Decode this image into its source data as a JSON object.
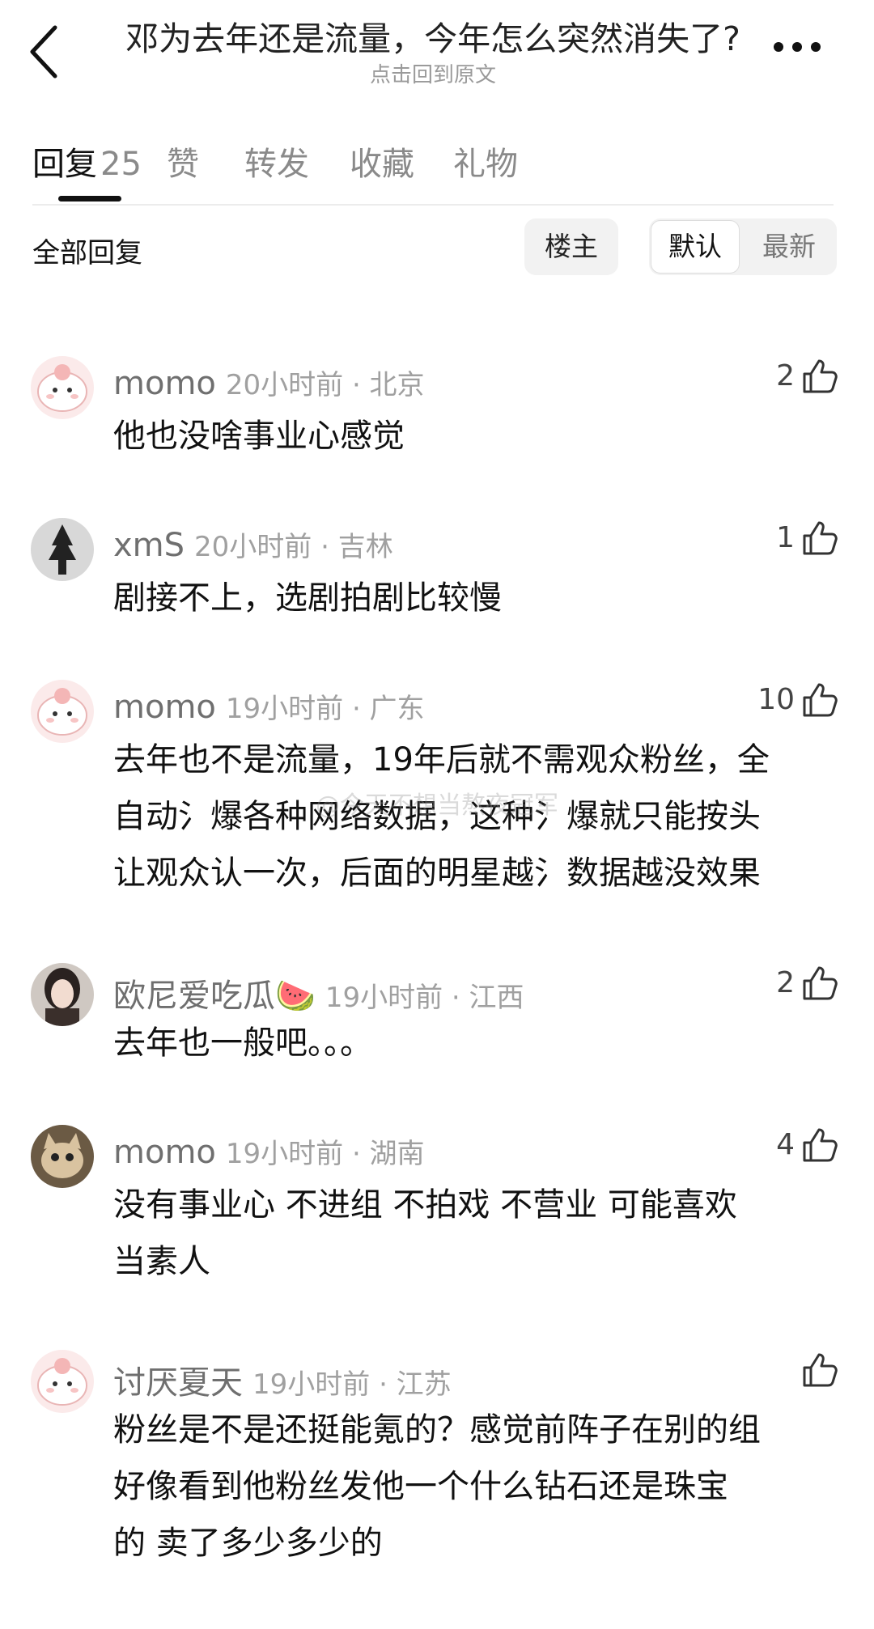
{
  "header": {
    "title": "邓为去年还是流量，今年怎么突然消失了?",
    "subtitle": "点击回到原文"
  },
  "tabs": [
    {
      "label": "回复",
      "count": "25"
    },
    {
      "label": "赞"
    },
    {
      "label": "转发"
    },
    {
      "label": "收藏"
    },
    {
      "label": "礼物"
    }
  ],
  "filter": {
    "title": "全部回复",
    "owner_chip": "楼主",
    "sort_default": "默认",
    "sort_latest": "最新"
  },
  "comments": [
    {
      "name": "momo",
      "time": "20小时前 · 北京",
      "likes": "2",
      "avatar": "pink-cartoon",
      "lines": [
        "他也没啥事业心感觉"
      ]
    },
    {
      "name": "xmS",
      "time": "20小时前 · 吉林",
      "likes": "1",
      "avatar": "tree-silhouette",
      "lines": [
        "剧接不上，选剧拍剧比较慢"
      ]
    },
    {
      "name": "momo",
      "time": "19小时前 · 广东",
      "likes": "10",
      "avatar": "pink-cartoon",
      "lines": [
        "去年也不是流量，19年后就不需观众粉丝，全",
        "自动氵爆各种网络数据，这种氵爆就只能按头",
        "让观众认一次，后面的明星越氵数据越没效果"
      ]
    },
    {
      "name": "欧尼爱吃瓜🍉",
      "time": "19小时前 · 江西",
      "likes": "2",
      "avatar": "woman-portrait",
      "lines": [
        "去年也一般吧。。。"
      ]
    },
    {
      "name": "momo",
      "time": "19小时前 · 湖南",
      "likes": "4",
      "avatar": "cat-photo",
      "lines": [
        "没有事业心 不进组 不拍戏 不营业 可能喜欢",
        "当素人"
      ]
    },
    {
      "name": "讨厌夏天",
      "time": "19小时前 · 江苏",
      "likes": "",
      "avatar": "pink-cartoon",
      "lines": [
        "粉丝是不是还挺能氪的？感觉前阵子在别的组",
        "好像看到他粉丝发他一个什么钻石还是珠宝",
        "的        卖了多少多少的"
      ]
    }
  ],
  "watermark": "@今天不想当熬夜冠军",
  "colors": {
    "text": "#111111",
    "muted": "#a0a0a0",
    "name": "#6f6f6f",
    "chip_bg": "#f2f2f2"
  }
}
